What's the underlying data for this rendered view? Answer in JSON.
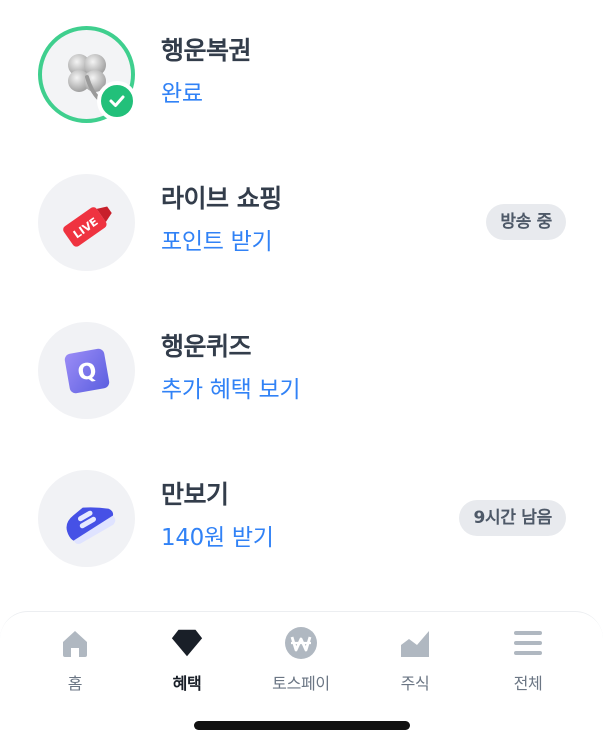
{
  "items": [
    {
      "title": "행운복권",
      "subtitle": "완료",
      "icon": "clover-icon",
      "status": "completed"
    },
    {
      "title": "라이브 쇼핑",
      "subtitle": "포인트 받기",
      "icon": "live-tag-icon",
      "icon_text": "LIVE",
      "badge": "방송 중"
    },
    {
      "title": "행운퀴즈",
      "subtitle": "추가 혜택 보기",
      "icon": "quiz-block-icon",
      "icon_text": "Q"
    },
    {
      "title": "만보기",
      "subtitle": "140원 받기",
      "icon": "sneaker-icon",
      "badge": "9시간 남음"
    }
  ],
  "tabbar": {
    "tabs": [
      {
        "label": "홈",
        "icon": "home-icon"
      },
      {
        "label": "혜택",
        "icon": "gem-icon",
        "active": true
      },
      {
        "label": "토스페이",
        "icon": "won-coin-icon"
      },
      {
        "label": "주식",
        "icon": "stock-chart-icon"
      },
      {
        "label": "전체",
        "icon": "menu-icon"
      }
    ]
  },
  "colors": {
    "accent_blue": "#3182f6",
    "title": "#333d4b",
    "done_green": "#22c07a",
    "pill_bg": "#e8eaee"
  }
}
